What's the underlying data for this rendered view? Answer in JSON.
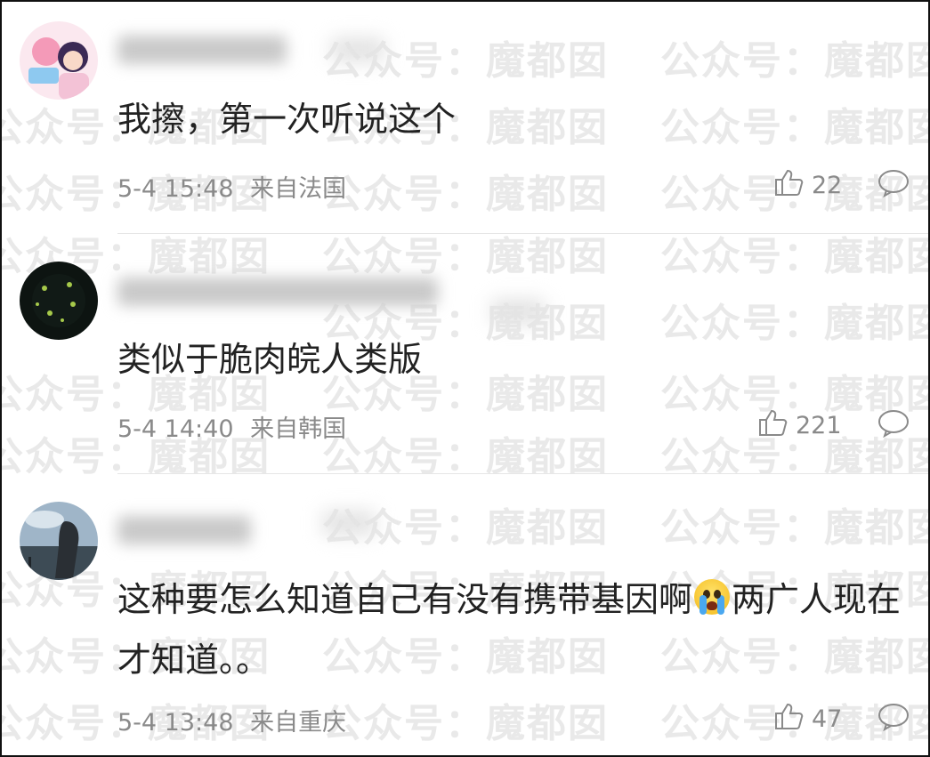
{
  "comments": [
    {
      "text": "我擦，第一次听说这个",
      "date": "5-4 15:48",
      "location": "来自法国",
      "likes": "22"
    },
    {
      "text": "类似于脆肉皖人类版",
      "date": "5-4 14:40",
      "location": "来自韩国",
      "likes": "221"
    },
    {
      "text_part1": "这种要怎么知道自己有没有携带基因啊",
      "emoji": "crying-face-emoji",
      "text_part2": "两广人现在才知道。。",
      "date": "5-4 13:48",
      "location": "来自重庆",
      "likes": "47"
    }
  ],
  "watermark": "公众号：魔都囡",
  "icons": {
    "like": "thumbs-up-icon",
    "reply": "comment-bubble-icon"
  },
  "colors": {
    "text": "#222222",
    "meta": "#8a8a8a",
    "watermark": "#e9e9e9"
  }
}
